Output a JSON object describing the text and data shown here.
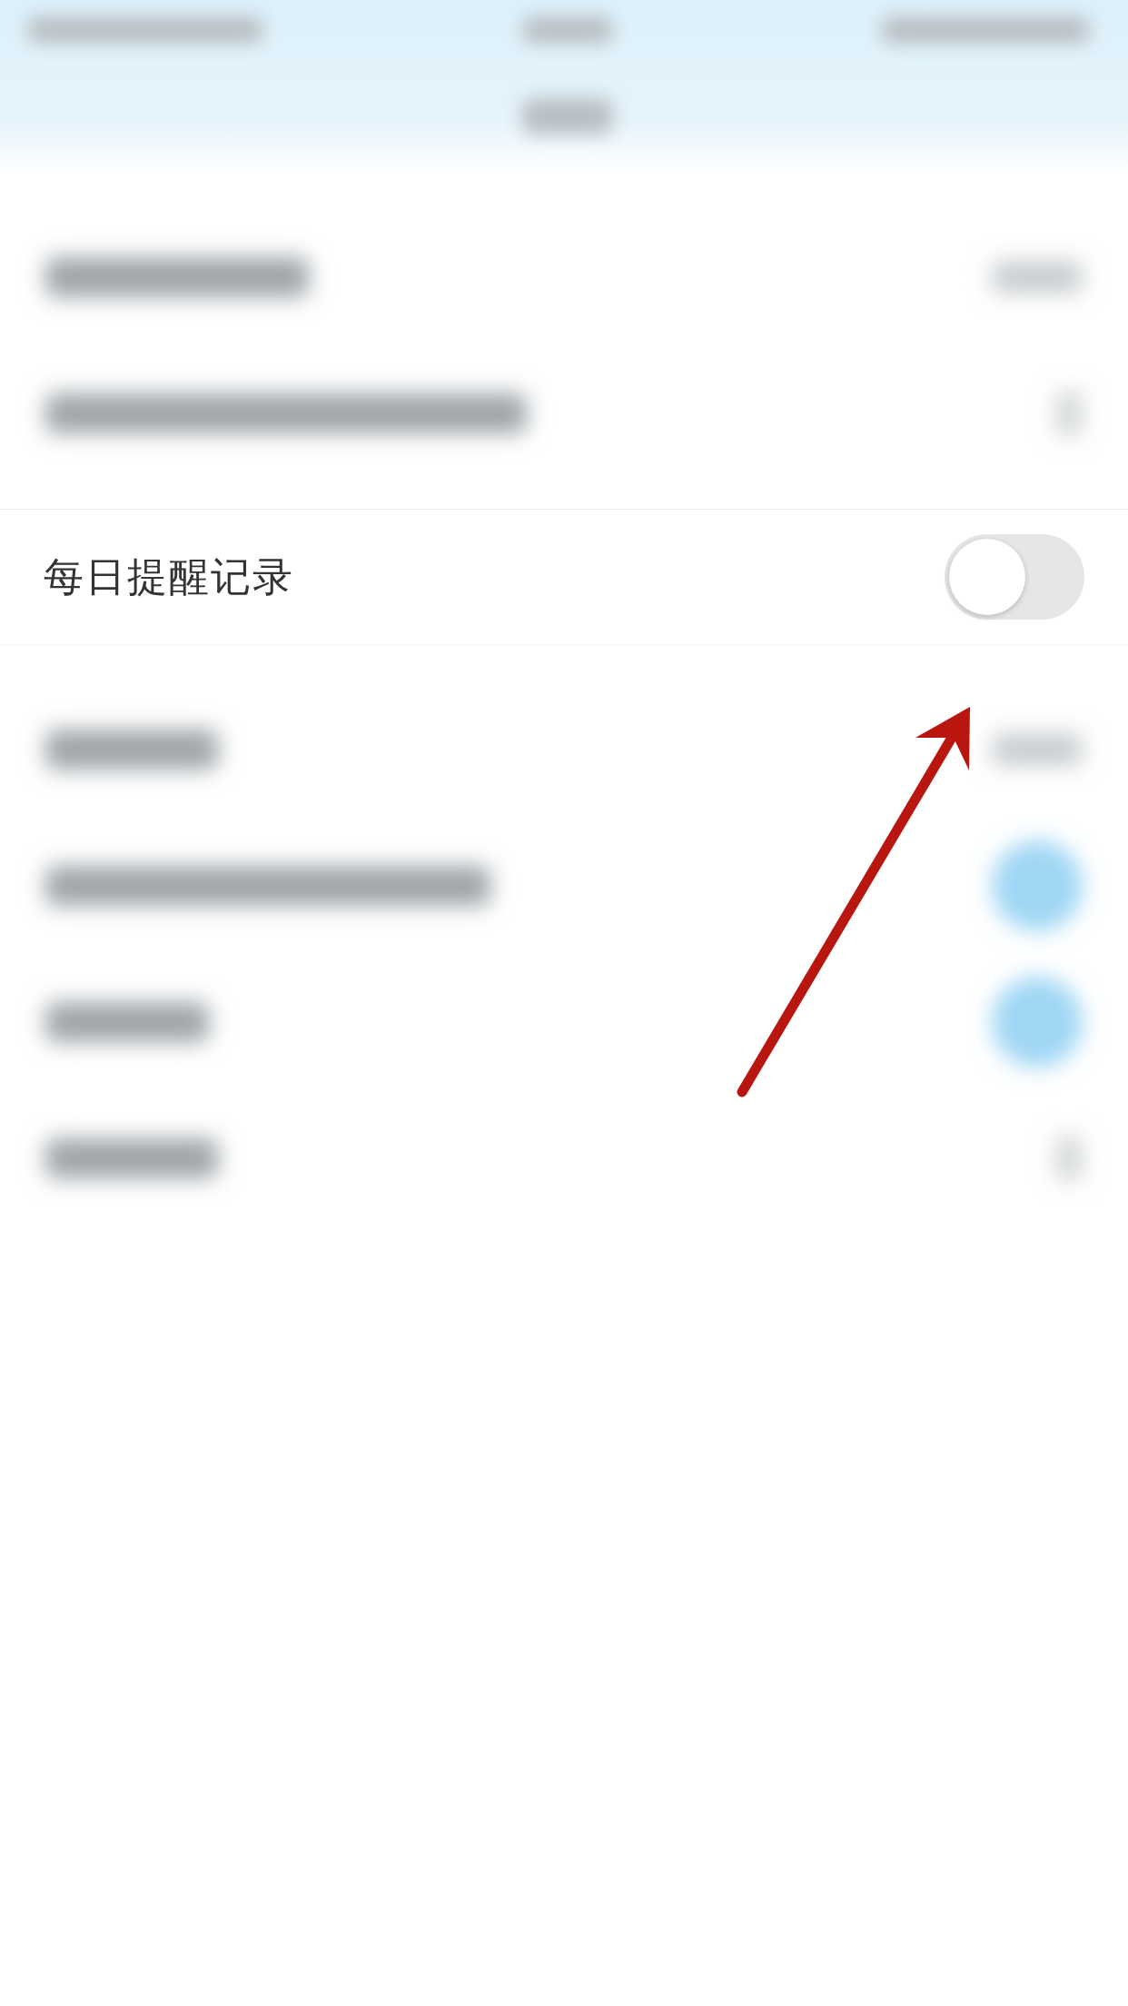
{
  "header": {
    "kind": "blurred"
  },
  "blurred_rows_top": [
    {
      "kind": "value"
    },
    {
      "kind": "chevron"
    }
  ],
  "reminder_row": {
    "label": "每日提醒记录",
    "on": false
  },
  "blurred_rows_bottom": [
    {
      "kind": "value"
    },
    {
      "kind": "toggle"
    },
    {
      "kind": "toggle"
    },
    {
      "kind": "chevron"
    }
  ],
  "annotation": {
    "kind": "arrow"
  }
}
